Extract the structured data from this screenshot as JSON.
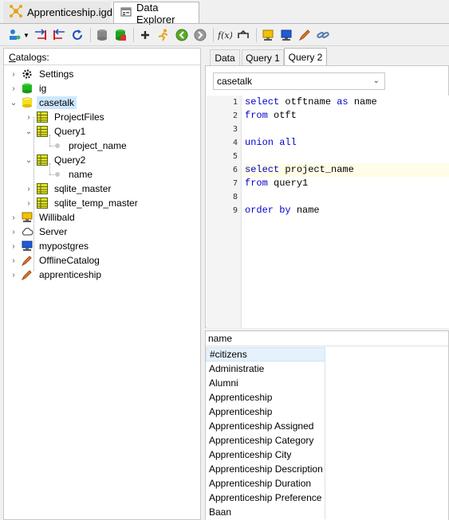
{
  "doc_tabs": [
    {
      "label": "Apprenticeship.igd",
      "icon": "network-icon"
    },
    {
      "label": "Data Explorer",
      "icon": "explorer-icon"
    }
  ],
  "catalogs_label_first": "C",
  "catalogs_label_rest": "atalogs:",
  "tree": {
    "settings": "Settings",
    "ig": "ig",
    "casetalk": "casetalk",
    "projectfiles": "ProjectFiles",
    "query1": "Query1",
    "project_name": "project_name",
    "query2": "Query2",
    "name": "name",
    "sqlite_master": "sqlite_master",
    "sqlite_temp_master": "sqlite_temp_master",
    "willibald": "Willibald",
    "server": "Server",
    "mypostgres": "mypostgres",
    "offlinecatalog": "OfflineCatalog",
    "apprenticeship": "apprenticeship"
  },
  "query_tabs": [
    "Data",
    "Query 1",
    "Query 2"
  ],
  "catalog_select": "casetalk",
  "editor": {
    "line_numbers": [
      "1",
      "2",
      "3",
      "4",
      "5",
      "6",
      "7",
      "8",
      "9"
    ],
    "lines": [
      [
        {
          "t": "select",
          "k": true
        },
        {
          "t": " otftname ",
          "k": false
        },
        {
          "t": "as",
          "k": true
        },
        {
          "t": " name",
          "k": false
        }
      ],
      [
        {
          "t": "from",
          "k": true
        },
        {
          "t": " otft",
          "k": false
        }
      ],
      [],
      [
        {
          "t": "union",
          "k": true
        },
        {
          "t": " ",
          "k": false
        },
        {
          "t": "all",
          "k": true
        }
      ],
      [],
      [
        {
          "t": "select",
          "k": true
        },
        {
          "t": " project_name",
          "k": false
        }
      ],
      [
        {
          "t": "from",
          "k": true
        },
        {
          "t": " query1",
          "k": false
        }
      ],
      [],
      [
        {
          "t": "order",
          "k": true
        },
        {
          "t": " ",
          "k": false
        },
        {
          "t": "by",
          "k": true
        },
        {
          "t": " name",
          "k": false
        }
      ]
    ],
    "current_line": 6
  },
  "results": {
    "column": "name",
    "rows": [
      "#citizens",
      "Administratie",
      "Alumni",
      "Apprenticeship",
      "Apprenticeship",
      "Apprenticeship Assigned",
      "Apprenticeship Category",
      "Apprenticeship City",
      "Apprenticeship Description",
      "Apprenticeship Duration",
      "Apprenticeship Preference",
      "Baan"
    ]
  }
}
